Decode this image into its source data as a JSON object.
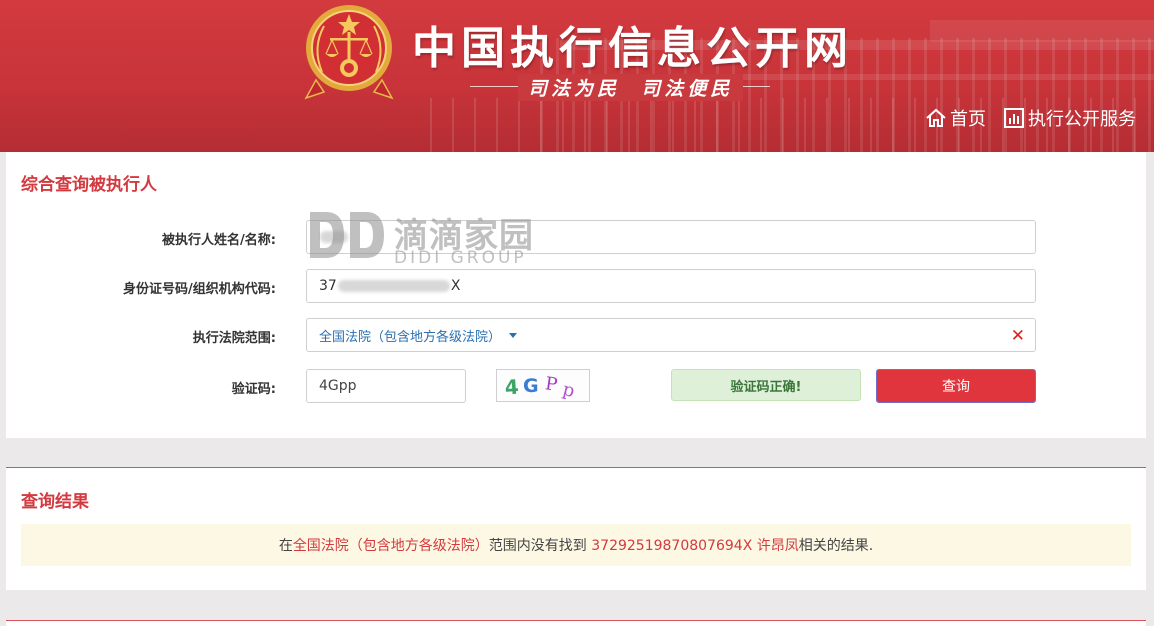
{
  "header": {
    "site_title": "中国执行信息公开网",
    "slogan": "司法为民  司法便民",
    "nav": {
      "home_label": "首页",
      "service_label": "执行公开服务",
      "home_icon": "home-icon",
      "service_icon": "chart-icon"
    },
    "emblem_icon": "court-emblem-icon"
  },
  "search_panel": {
    "title": "综合查询被执行人",
    "name_label": "被执行人姓名/名称:",
    "id_label": "身份证号码/组织机构代码:",
    "id_prefix": "37",
    "id_suffix": "X",
    "court_label": "执行法院范围:",
    "court_value": "全国法院（包含地方各级法院）",
    "captcha_label": "验证码:",
    "captcha_value": "4Gpp",
    "captcha_image_text": "4GPp",
    "captcha_status": "验证码正确!",
    "search_button": "查询",
    "clear_icon": "close-icon"
  },
  "watermark": {
    "logo": "DD",
    "cn": "滴滴家园",
    "en": "DIDI GROUP"
  },
  "result_panel": {
    "title": "查询结果",
    "msg_pre": "在",
    "msg_court": "全国法院（包含地方各级法院）",
    "msg_mid": "范围内没有找到 ",
    "msg_id_name": "37292519870807694X 许昂凤",
    "msg_post": "相关的结果."
  },
  "colors": {
    "brand_red": "#d33a3f",
    "header_red": "#c8343a",
    "success_bg": "#dff0d8",
    "result_bg": "#fcf8e3",
    "link_blue": "#2a6fb0"
  }
}
